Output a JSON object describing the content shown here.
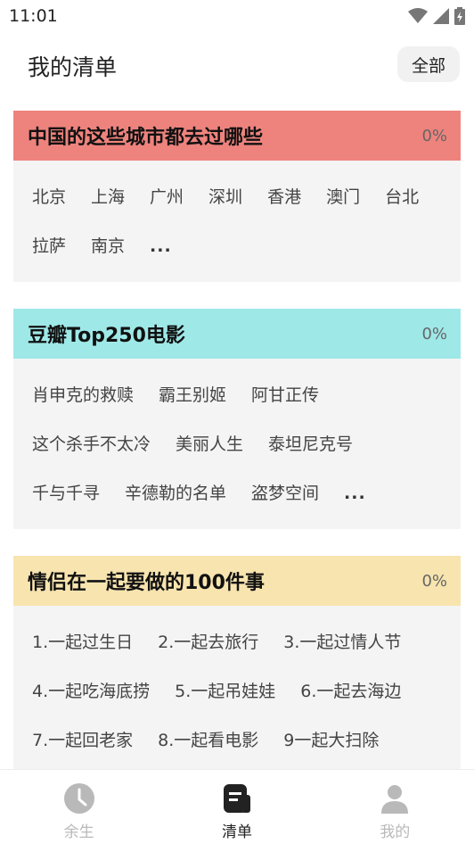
{
  "status": {
    "time": "11:01"
  },
  "header": {
    "title": "我的清单",
    "filter_label": "全部"
  },
  "lists": [
    {
      "title": "中国的这些城市都去过哪些",
      "percent": "0%",
      "color": "#ee837d",
      "items": [
        "北京",
        "上海",
        "广州",
        "深圳",
        "香港",
        "澳门",
        "台北",
        "拉萨",
        "南京"
      ],
      "more": "..."
    },
    {
      "title": "豆瓣Top250电影",
      "percent": "0%",
      "color": "#9fe8e8",
      "items": [
        "肖申克的救赎",
        "霸王别姬",
        "阿甘正传",
        "这个杀手不太冷",
        "美丽人生",
        "泰坦尼克号",
        "千与千寻",
        "辛德勒的名单",
        "盗梦空间"
      ],
      "more": "..."
    },
    {
      "title": "情侣在一起要做的100件事",
      "percent": "0%",
      "color": "#f8e4af",
      "items": [
        "1.一起过生日",
        "2.一起去旅行",
        "3.一起过情人节",
        "4.一起吃海底捞",
        "5.一起吊娃娃",
        "6.一起去海边",
        "7.一起回老家",
        "8.一起看电影",
        "9一起大扫除"
      ],
      "more": "..."
    }
  ],
  "tabbar": {
    "tabs": [
      {
        "label": "余生",
        "icon": "clock-icon",
        "active": false
      },
      {
        "label": "清单",
        "icon": "list-icon",
        "active": true
      },
      {
        "label": "我的",
        "icon": "person-icon",
        "active": false
      }
    ],
    "active_color": "#222222",
    "inactive_color": "#b9b9b9"
  }
}
